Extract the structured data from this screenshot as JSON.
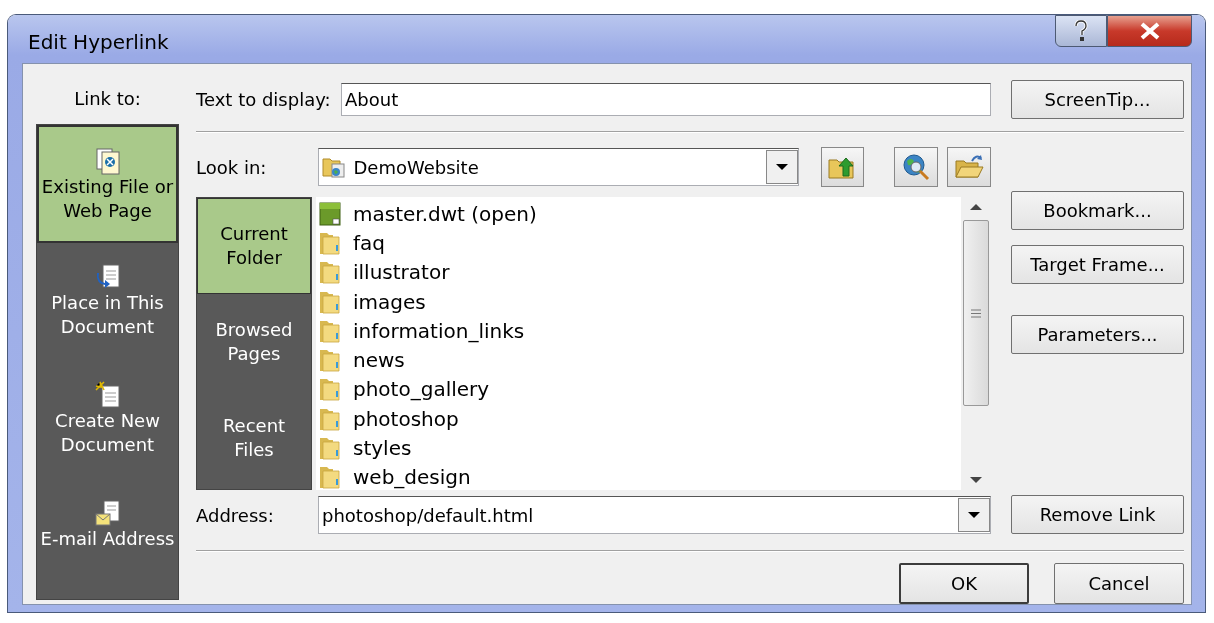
{
  "window": {
    "title": "Edit Hyperlink"
  },
  "link_to": {
    "label": "Link to:",
    "items": [
      {
        "label": "Existing File or Web Page",
        "kind": "file",
        "selected": true
      },
      {
        "label": "Place in This Document",
        "kind": "place",
        "selected": false
      },
      {
        "label": "Create New Document",
        "kind": "new",
        "selected": false
      },
      {
        "label": "E-mail Address",
        "kind": "email",
        "selected": false
      }
    ]
  },
  "text_to_display": {
    "label": "Text to display:",
    "value": "About"
  },
  "screentip_button": "ScreenTip...",
  "look_in": {
    "label": "Look in:",
    "value": "DemoWebsite"
  },
  "browse_tabs": [
    {
      "label": "Current Folder",
      "selected": true
    },
    {
      "label": "Browsed Pages",
      "selected": false
    },
    {
      "label": "Recent Files",
      "selected": false
    }
  ],
  "files": [
    {
      "name": "master.dwt (open)",
      "kind": "template"
    },
    {
      "name": "faq",
      "kind": "folder"
    },
    {
      "name": "illustrator",
      "kind": "folder"
    },
    {
      "name": "images",
      "kind": "folder"
    },
    {
      "name": "information_links",
      "kind": "folder"
    },
    {
      "name": "news",
      "kind": "folder"
    },
    {
      "name": "photo_gallery",
      "kind": "folder"
    },
    {
      "name": "photoshop",
      "kind": "folder"
    },
    {
      "name": "styles",
      "kind": "folder"
    },
    {
      "name": "web_design",
      "kind": "folder"
    }
  ],
  "side_buttons": [
    "Bookmark...",
    "Target Frame...",
    "Parameters..."
  ],
  "remove_link_button": "Remove Link",
  "address": {
    "label": "Address:",
    "value": "photoshop/default.html"
  },
  "footer_buttons": [
    {
      "label": "OK",
      "default": true
    },
    {
      "label": "Cancel",
      "default": false
    }
  ]
}
